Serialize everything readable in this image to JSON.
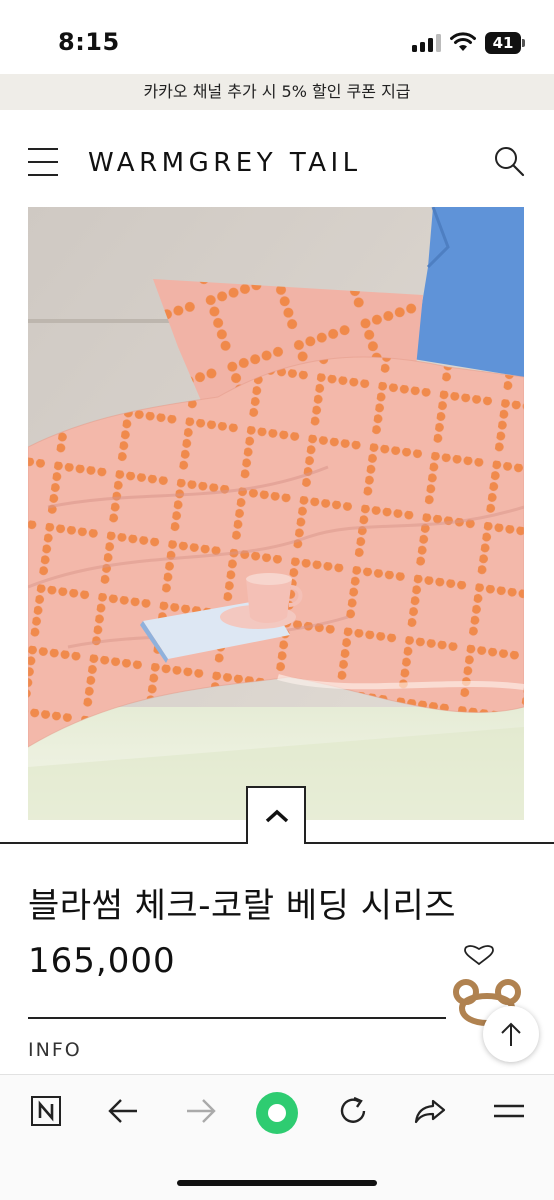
{
  "status_bar": {
    "time": "8:15",
    "battery_level": "41"
  },
  "promo_banner": {
    "text": "카카오 채널 추가 시 5% 할인 쿠폰 지급"
  },
  "header": {
    "logo": "WARMGREY TAIL",
    "icons": [
      "menu-icon",
      "search-icon"
    ]
  },
  "product": {
    "title": "블라썸 체크-코랄 베딩 시리즈",
    "price": "165,000",
    "info_label": "INFO"
  },
  "colors": {
    "promo_bg": "#efede8",
    "bedding_pink": "#f0b1a4",
    "bedding_orange": "#f0894a",
    "pillow_blue": "#5f93d8",
    "toolbar_green": "#2ecc71"
  },
  "toolbar": {
    "icons": [
      "naver-n-icon",
      "back-arrow-icon",
      "forward-arrow-icon",
      "green-circle-icon",
      "reload-icon",
      "share-icon",
      "menu-lines-icon"
    ]
  }
}
